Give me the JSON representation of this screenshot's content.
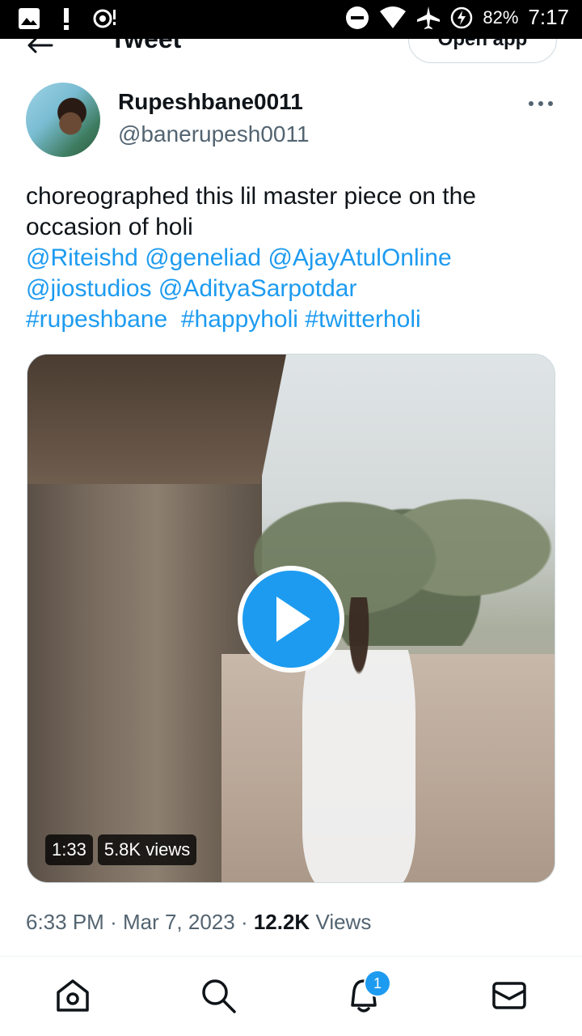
{
  "status_bar": {
    "battery": "82%",
    "time": "7:17"
  },
  "header": {
    "title": "Tweet",
    "open_app_label": "Open app"
  },
  "author": {
    "display_name": "Rupeshbane0011",
    "handle": "@banerupesh0011"
  },
  "tweet": {
    "text_line1": "choreographed this lil master piece on the",
    "text_line2": "occasion of holi",
    "mentions_line1": [
      "@Riteishd",
      "@geneliad",
      "@AjayAtulOnline"
    ],
    "mentions_line2": [
      "@jiostudios",
      "@AdityaSarpotdar"
    ],
    "hashtags": [
      "#rupeshbane",
      "#happyholi",
      "#twitterholi"
    ]
  },
  "media": {
    "duration": "1:33",
    "views": "5.8K views"
  },
  "meta": {
    "time": "6:33 PM",
    "date": "Mar 7, 2023",
    "views_count": "12.2K",
    "views_label": "Views"
  },
  "nav": {
    "notifications_count": "1"
  },
  "colors": {
    "accent": "#1d9bf0",
    "text": "#0f1419",
    "secondary_text": "#536471"
  }
}
